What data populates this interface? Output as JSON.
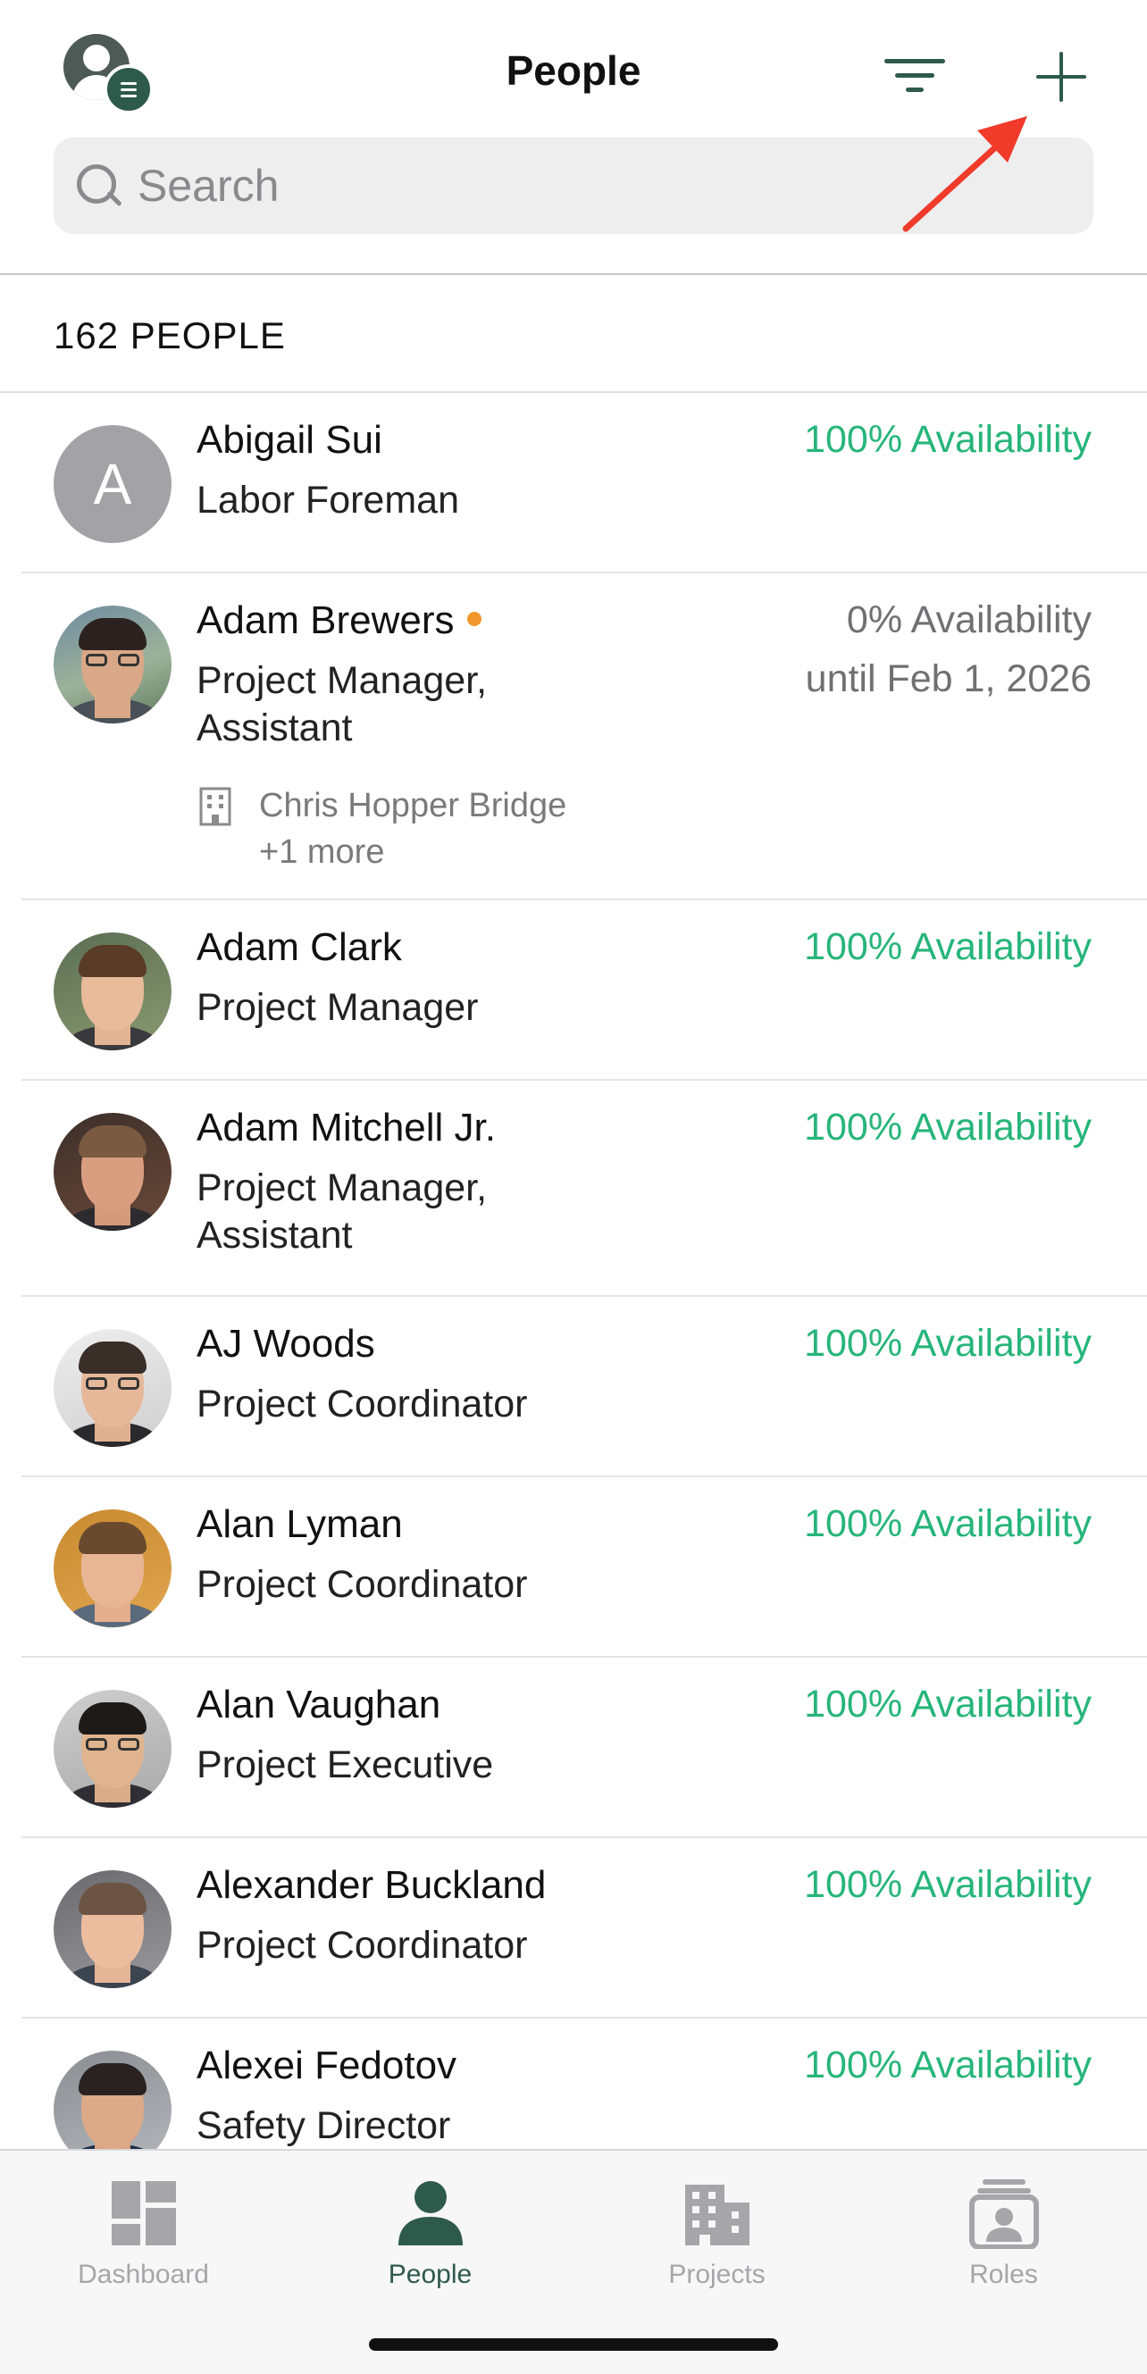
{
  "header": {
    "title": "People",
    "profile_icon": "profile-menu-icon",
    "filter_icon": "filter-icon",
    "add_icon": "plus-icon"
  },
  "search": {
    "placeholder": "Search",
    "value": ""
  },
  "people_count_label": "162 PEOPLE",
  "people": [
    {
      "name": "Abigail Sui",
      "role": "Labor Foreman",
      "availability": "100% Availability",
      "avatar_initial": "A"
    },
    {
      "name": "Adam Brewers",
      "role": "Project Manager, Assistant",
      "availability": "0% Availability",
      "availability_until": "until Feb 1, 2026",
      "status": "orange-dot",
      "project": "Chris Hopper Bridge",
      "project_more": "+1 more"
    },
    {
      "name": "Adam Clark",
      "role": "Project Manager",
      "availability": "100% Availability"
    },
    {
      "name": "Adam Mitchell Jr.",
      "role": "Project Manager, Assistant",
      "availability": "100% Availability"
    },
    {
      "name": "AJ Woods",
      "role": "Project Coordinator",
      "availability": "100% Availability"
    },
    {
      "name": "Alan Lyman",
      "role": "Project Coordinator",
      "availability": "100% Availability"
    },
    {
      "name": "Alan Vaughan",
      "role": "Project Executive",
      "availability": "100% Availability"
    },
    {
      "name": "Alexander Buckland",
      "role": "Project Coordinator",
      "availability": "100% Availability"
    },
    {
      "name": "Alexei Fedotov",
      "role": "Safety Director",
      "availability": "100% Availability"
    }
  ],
  "tabs": [
    {
      "label": "Dashboard",
      "icon": "dashboard-icon",
      "active": false
    },
    {
      "label": "People",
      "icon": "person-icon",
      "active": true
    },
    {
      "label": "Projects",
      "icon": "building-icon",
      "active": false
    },
    {
      "label": "Roles",
      "icon": "id-badge-icon",
      "active": false
    }
  ],
  "colors": {
    "brand": "#2e5a4b",
    "available": "#27b57a",
    "unavailable": "#707074",
    "status_dot": "#f0962b",
    "annotation": "#f03a2a"
  }
}
